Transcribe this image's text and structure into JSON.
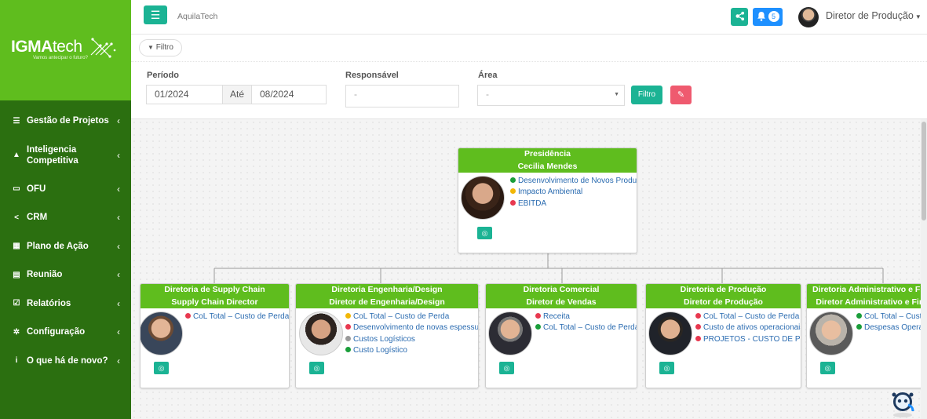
{
  "brand": {
    "logo_main": "IGMA",
    "logo_sub": "tech",
    "tagline": "Vamos antecipar o futuro?"
  },
  "sidebar": {
    "items": [
      {
        "label": "Gestão de Projetos",
        "icon": "tasks-icon"
      },
      {
        "label": "Inteligencia Competitiva",
        "icon": "graduation-cap-icon"
      },
      {
        "label": "OFU",
        "icon": "credit-card-icon"
      },
      {
        "label": "CRM",
        "icon": "share-icon"
      },
      {
        "label": "Plano de Ação",
        "icon": "calendar-check-icon"
      },
      {
        "label": "Reunião",
        "icon": "id-card-icon"
      },
      {
        "label": "Relatórios",
        "icon": "check-square-icon"
      },
      {
        "label": "Configuração",
        "icon": "gear-icon"
      },
      {
        "label": "O que há de novo?",
        "icon": "info-icon"
      }
    ]
  },
  "header": {
    "app_name": "AquilaTech",
    "notifications_count": "5",
    "user_name": "Diretor de Produção"
  },
  "filters": {
    "chip_label": "Filtro",
    "periodo_label": "Período",
    "period_from": "01/2024",
    "period_sep": "Até",
    "period_to": "08/2024",
    "responsavel_label": "Responsável",
    "responsavel_value": "-",
    "area_label": "Área",
    "area_value": "-",
    "filter_button": "Filtro"
  },
  "colors": {
    "accent_green": "#5fbd1e",
    "teal": "#1bb394",
    "status_green": "#1a9e3a",
    "status_yellow": "#f2b705",
    "status_red": "#e8384f",
    "status_gray": "#9a9a9a"
  },
  "org": {
    "root": {
      "area": "Presidência",
      "person": "Cecilia Mendes",
      "indicators": [
        {
          "status": "green",
          "label": "Desenvolvimento de Novos Produtos"
        },
        {
          "status": "yellow",
          "label": "Impacto Ambiental"
        },
        {
          "status": "red",
          "label": "EBITDA"
        }
      ]
    },
    "children": [
      {
        "area": "Diretoria de Supply Chain",
        "role": "Supply Chain Director",
        "indicators": [
          {
            "status": "red",
            "label": "CoL Total – Custo de Perda"
          }
        ]
      },
      {
        "area": "Diretoria Engenharia/Design",
        "role": "Diretor de Engenharia/Design",
        "indicators": [
          {
            "status": "yellow",
            "label": "CoL Total – Custo de Perda"
          },
          {
            "status": "red",
            "label": "Desenvolvimento de novas espessuras"
          },
          {
            "status": "gray",
            "label": "Custos Logísticos"
          },
          {
            "status": "green",
            "label": "Custo Logístico"
          }
        ]
      },
      {
        "area": "Diretoria Comercial",
        "role": "Diretor de Vendas",
        "indicators": [
          {
            "status": "red",
            "label": "Receita"
          },
          {
            "status": "green",
            "label": "CoL Total – Custo de Perda"
          }
        ]
      },
      {
        "area": "Diretoria de Produção",
        "role": "Diretor de Produção",
        "indicators": [
          {
            "status": "red",
            "label": "CoL Total – Custo de Perda"
          },
          {
            "status": "red",
            "label": "Custo de ativos operacionais"
          },
          {
            "status": "red",
            "label": "PROJETOS - CUSTO DE PERDA"
          }
        ]
      },
      {
        "area": "Diretoria Administrativo e Financeiro",
        "role": "Diretor Administrativo e Financeiro",
        "indicators": [
          {
            "status": "green",
            "label": "CoL Total – Custo de Perda"
          },
          {
            "status": "green",
            "label": "Despesas Operacionais"
          }
        ]
      }
    ]
  }
}
